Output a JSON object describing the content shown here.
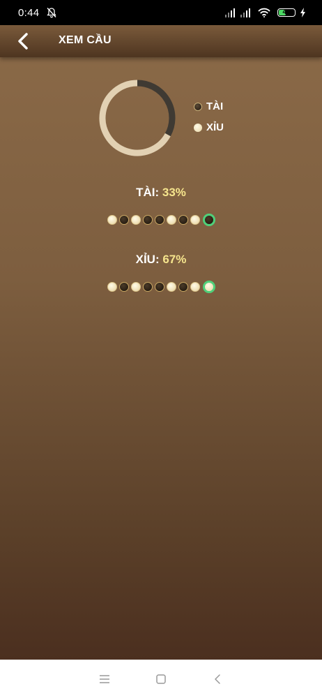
{
  "status_bar": {
    "time": "0:44",
    "battery": "48",
    "battery_fill_fraction": 0.48,
    "icons": [
      "bell-off-icon",
      "signal-icon",
      "signal-icon",
      "wifi-icon",
      "battery-icon",
      "charging-icon"
    ]
  },
  "header": {
    "title": "XEM CẦU",
    "back_icon": "chevron-left-icon"
  },
  "chart_data": {
    "type": "pie",
    "style": "donut",
    "categories": [
      "TÀI",
      "XỈU"
    ],
    "values": [
      33,
      67
    ],
    "colors": [
      "#3f3a33",
      "#e2d1b3"
    ]
  },
  "legend": {
    "tai": "TÀI",
    "xiu": "XỈU"
  },
  "tai_stat": {
    "label": "TÀI:",
    "percent": "33%",
    "sequence": [
      "xiu",
      "tai",
      "xiu",
      "tai",
      "tai",
      "xiu",
      "tai",
      "xiu",
      "tai"
    ]
  },
  "xiu_stat": {
    "label": "XỈU:",
    "percent": "67%",
    "sequence": [
      "xiu",
      "tai",
      "xiu",
      "tai",
      "tai",
      "xiu",
      "tai",
      "xiu",
      "xiu"
    ]
  },
  "colors": {
    "highlight_ring": "#4fd07a",
    "percent_text": "#f6e58d"
  },
  "nav_bar": {
    "icons": [
      "menu-icon",
      "home-square-icon",
      "back-triangle-icon"
    ]
  }
}
